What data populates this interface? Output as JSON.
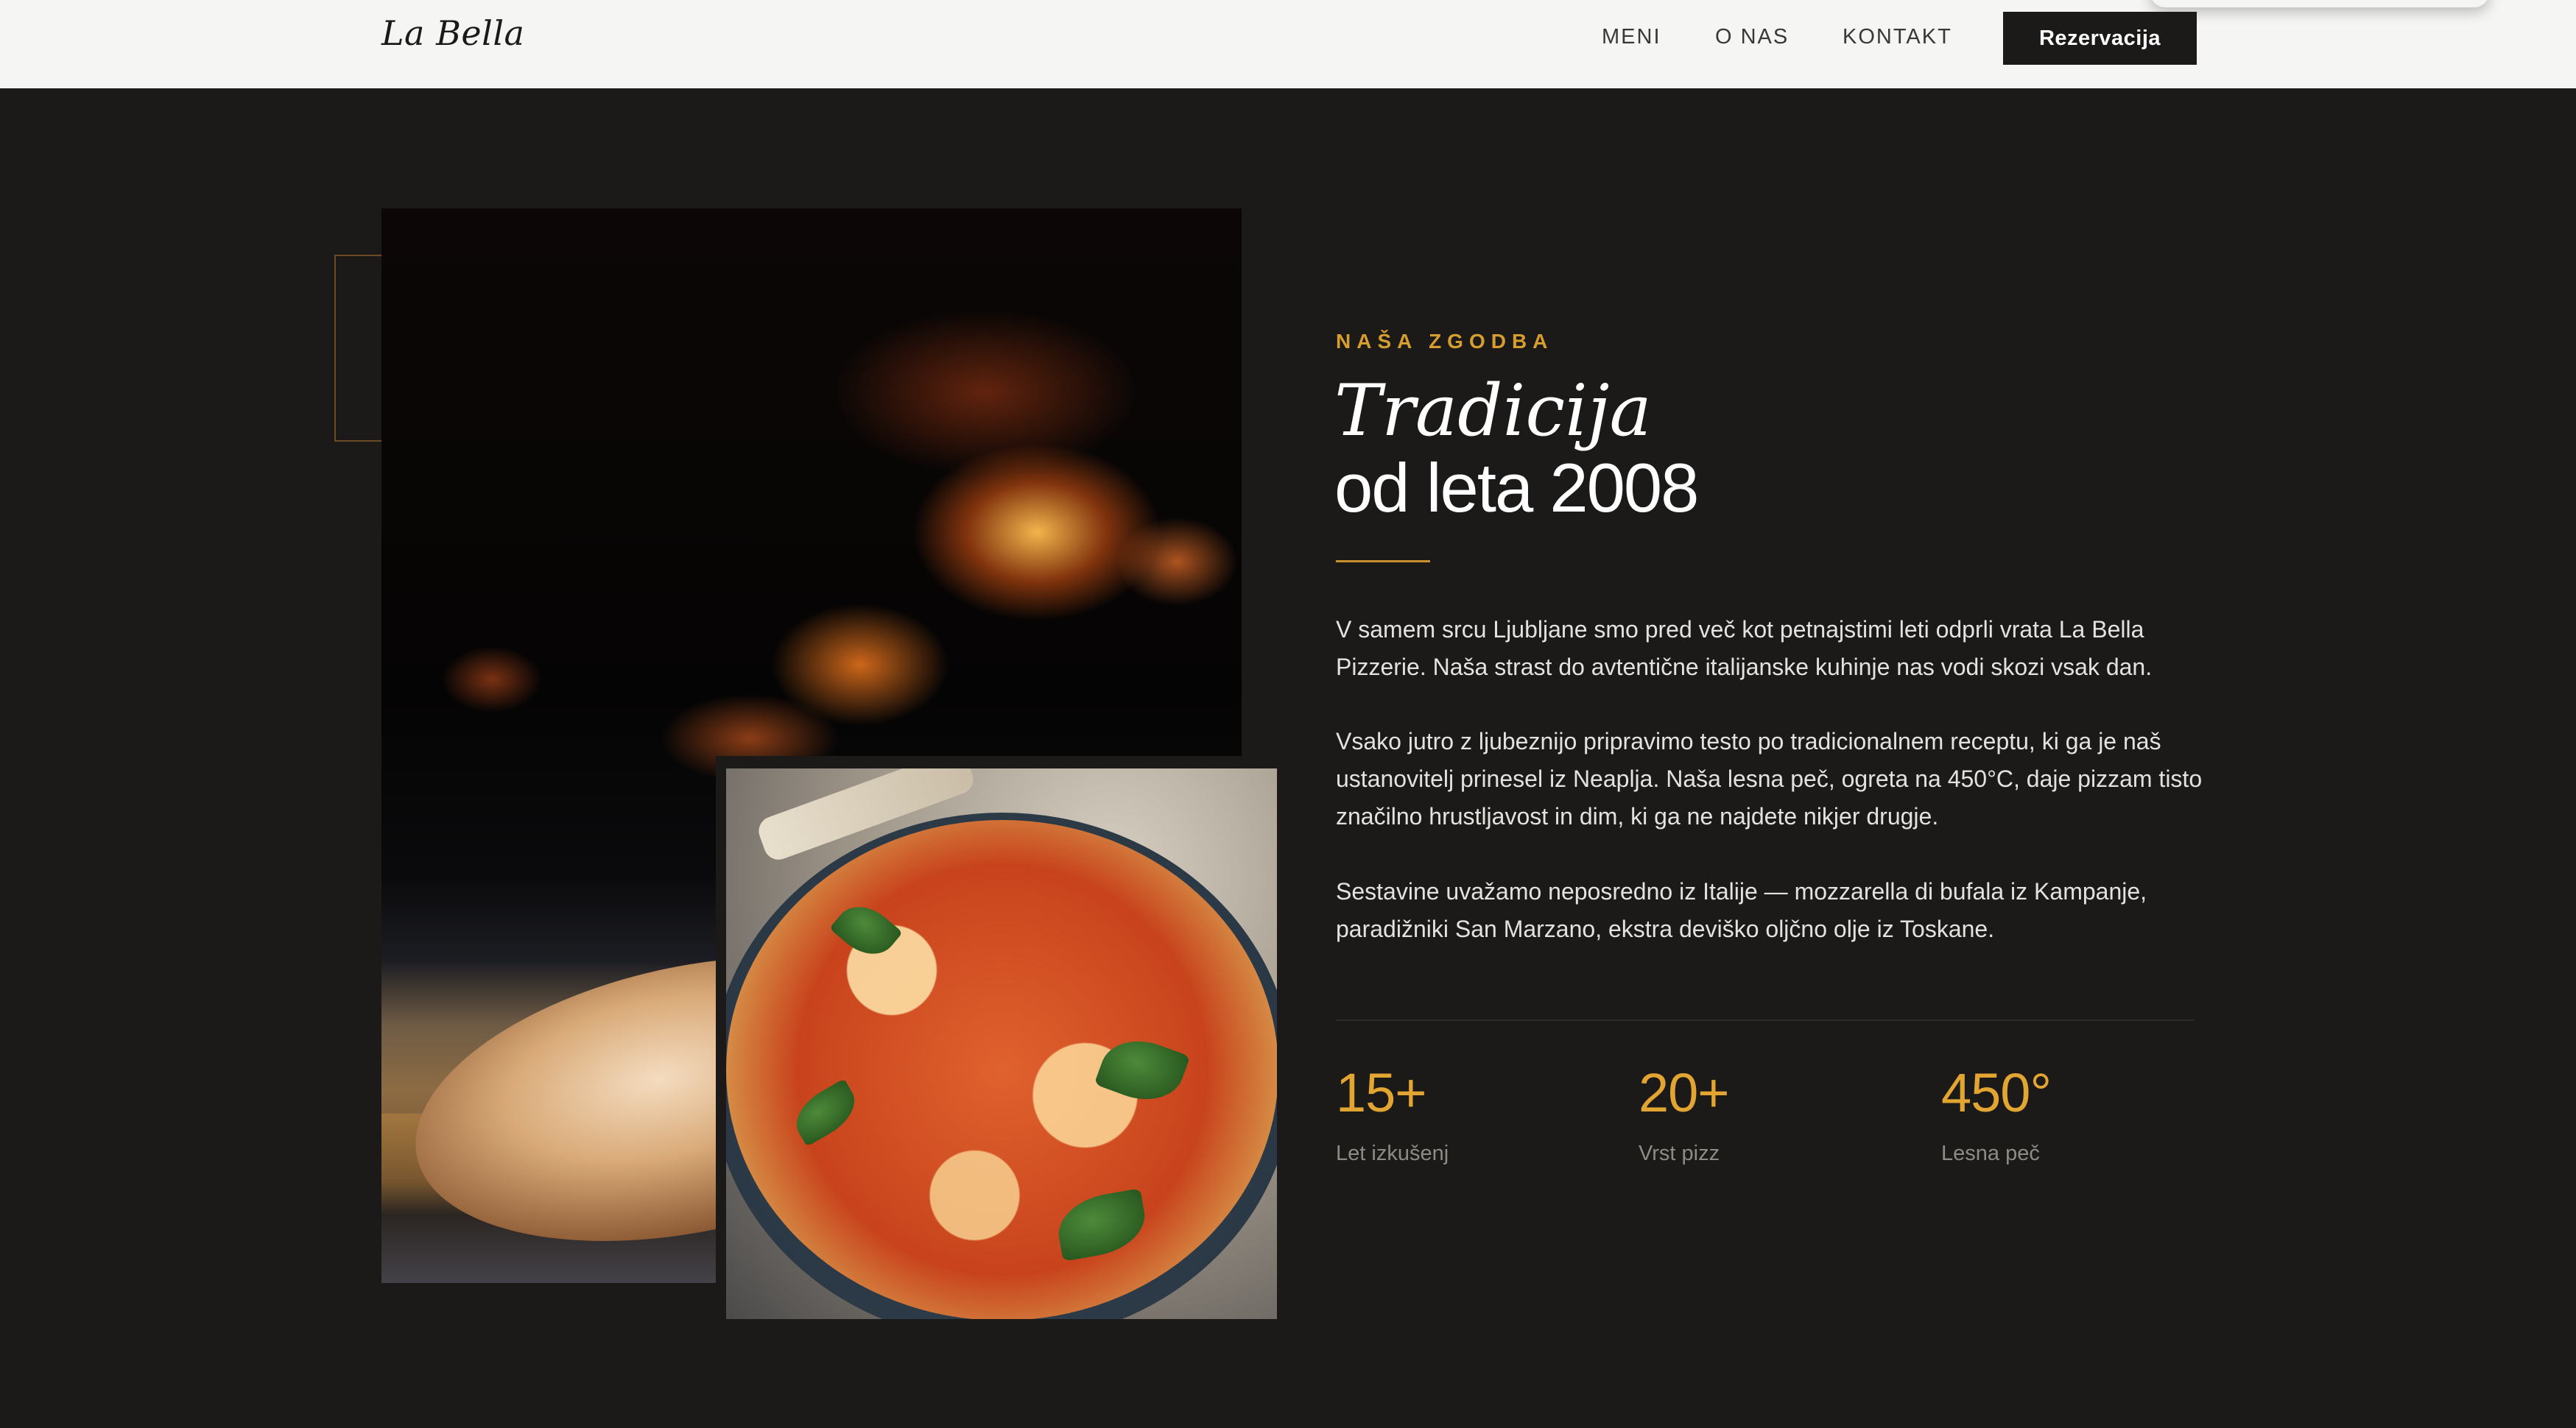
{
  "header": {
    "logo": "La Bella",
    "nav": [
      "MENI",
      "O NAS",
      "KONTAKT"
    ],
    "cta_label": "Rezervacija"
  },
  "story": {
    "eyebrow": "NAŠA ZGODBA",
    "title_italic": "Tradicija",
    "title_plain": "od leta 2008",
    "paragraphs": [
      "V samem srcu Ljubljane smo pred več kot petnajstimi leti odprli vrata La Bella Pizzerie. Naša strast do avtentične italijanske kuhinje nas vodi skozi vsak dan.",
      "Vsako jutro z ljubeznijo pripravimo testo po tradicionalnem receptu, ki ga je naš ustanovitelj prinesel iz Neaplja. Naša lesna peč, ogreta na 450°C, daje pizzam tisto značilno hrustljavost in dim, ki ga ne najdete nikjer drugje.",
      "Sestavine uvažamo neposredno iz Italije — mozzarella di bufala iz Kampanje, paradižniki San Marzano, ekstra deviško oljčno olje iz Toskane."
    ],
    "stats": [
      {
        "value": "15+",
        "label": "Let izkušenj"
      },
      {
        "value": "20+",
        "label": "Vrst pizz"
      },
      {
        "value": "450°",
        "label": "Lesna peč"
      }
    ]
  },
  "images": {
    "main_photo": "wood-fired-oven-pizza-photo",
    "inset_photo": "margherita-pizza-photo"
  },
  "colors": {
    "background": "#1b1a19",
    "header_bg": "#f5f5f4",
    "accent": "#d69e2e",
    "text": "#e4e2df",
    "muted": "#8e8a84"
  }
}
